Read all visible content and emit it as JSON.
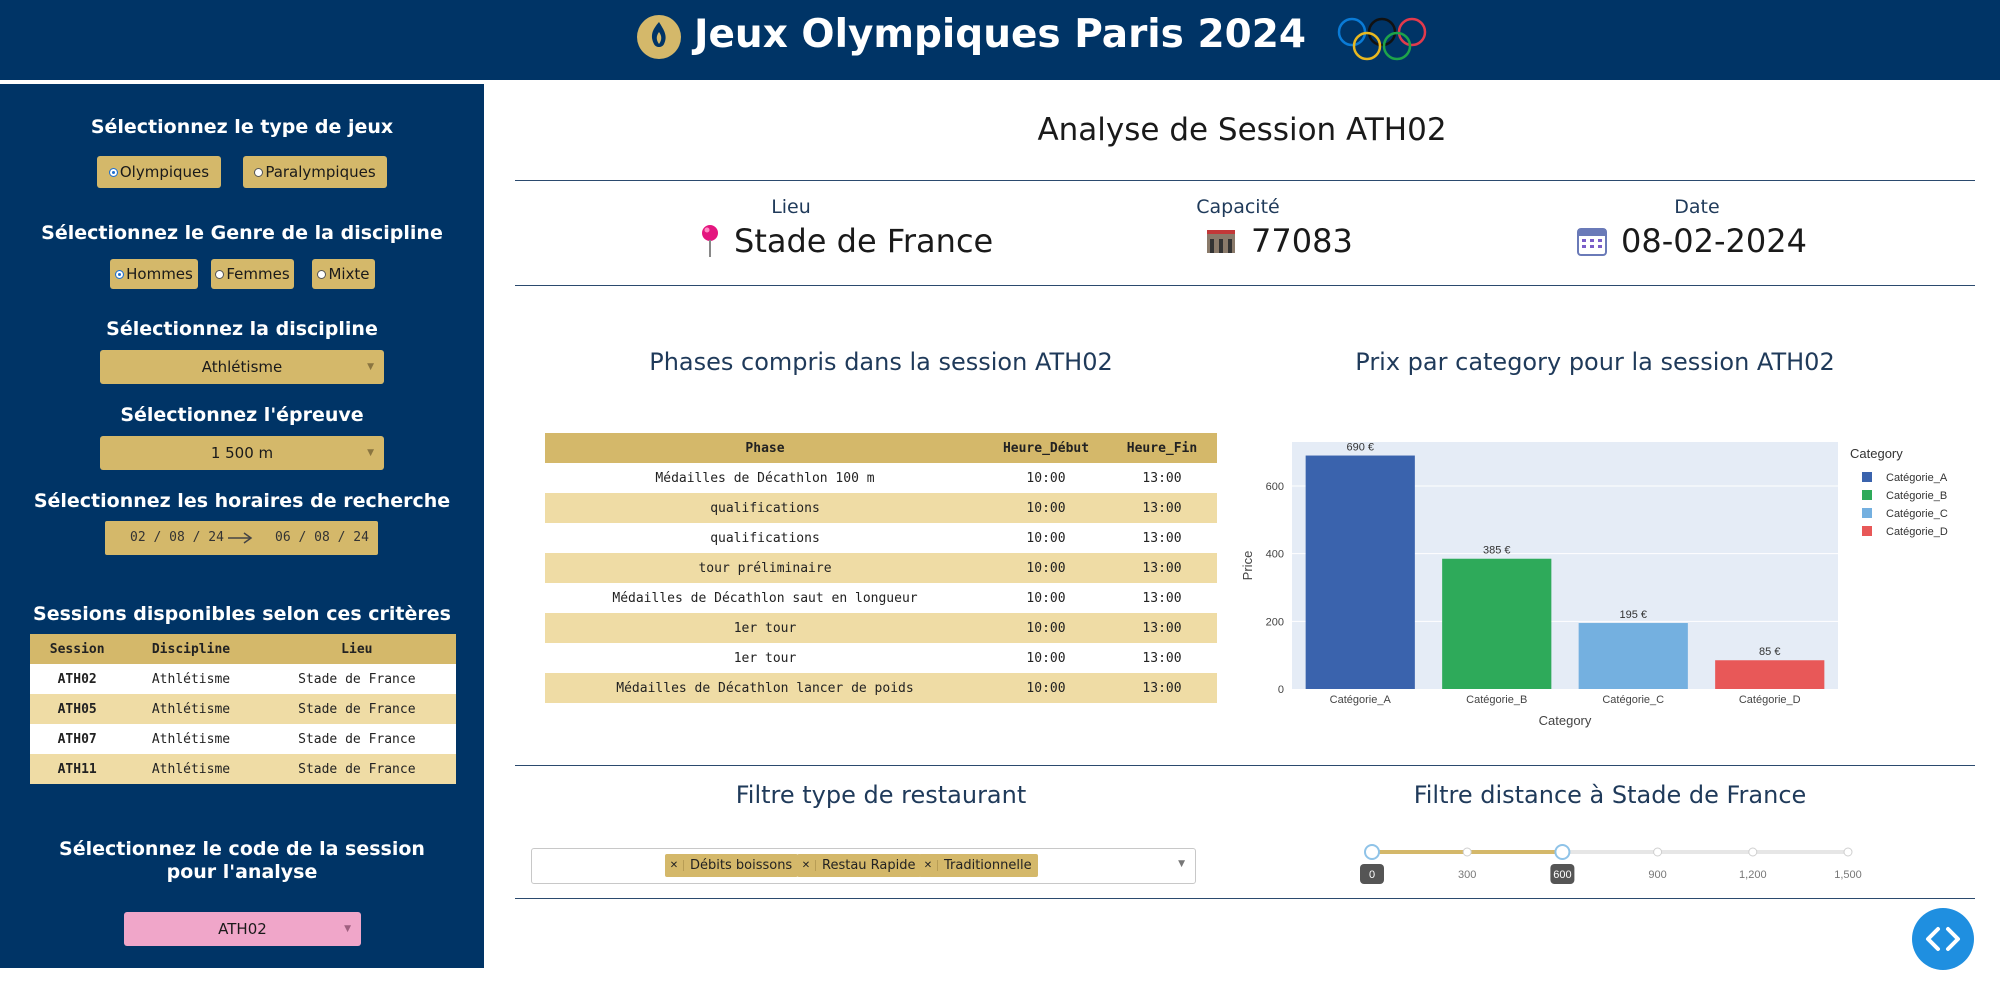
{
  "header": {
    "title": "Jeux Olympiques Paris 2024"
  },
  "sidebar": {
    "game_type": {
      "heading": "Sélectionnez le type de jeux",
      "options": [
        "Olympiques",
        "Paralympiques"
      ],
      "selected": "Olympiques"
    },
    "gender": {
      "heading": "Sélectionnez le Genre de la discipline",
      "options": [
        "Hommes",
        "Femmes",
        "Mixte"
      ],
      "selected": "Hommes"
    },
    "discipline": {
      "heading": "Sélectionnez la discipline",
      "value": "Athlétisme"
    },
    "event": {
      "heading": "Sélectionnez l'épreuve",
      "value": "1 500 m"
    },
    "dates": {
      "heading": "Sélectionnez les horaires de recherche",
      "start": "02 / 08 / 24",
      "end": "06 / 08 / 24"
    },
    "sessions": {
      "heading": "Sessions disponibles selon ces critères",
      "columns": [
        "Session",
        "Discipline",
        "Lieu"
      ],
      "rows": [
        [
          "ATH02",
          "Athlétisme",
          "Stade de France"
        ],
        [
          "ATH05",
          "Athlétisme",
          "Stade de France"
        ],
        [
          "ATH07",
          "Athlétisme",
          "Stade de France"
        ],
        [
          "ATH11",
          "Athlétisme",
          "Stade de France"
        ]
      ]
    },
    "session_code": {
      "heading": "Sélectionnez le code de la session pour l'analyse",
      "value": "ATH02"
    }
  },
  "main": {
    "title": "Analyse de Session ATH02",
    "info": {
      "lieu": {
        "label": "Lieu",
        "value": "Stade de France"
      },
      "capacite": {
        "label": "Capacité",
        "value": "77083"
      },
      "date": {
        "label": "Date",
        "value": "08-02-2024"
      }
    },
    "phases": {
      "title": "Phases compris dans la session ATH02",
      "columns": [
        "Phase",
        "Heure_Début",
        "Heure_Fin"
      ],
      "rows": [
        [
          "Médailles de Décathlon 100 m",
          "10:00",
          "13:00"
        ],
        [
          "qualifications",
          "10:00",
          "13:00"
        ],
        [
          "qualifications",
          "10:00",
          "13:00"
        ],
        [
          "tour préliminaire",
          "10:00",
          "13:00"
        ],
        [
          "Médailles de Décathlon saut en longueur",
          "10:00",
          "13:00"
        ],
        [
          "1er tour",
          "10:00",
          "13:00"
        ],
        [
          "1er tour",
          "10:00",
          "13:00"
        ],
        [
          "Médailles de Décathlon lancer de poids",
          "10:00",
          "13:00"
        ]
      ]
    },
    "price_chart_title": "Prix par category pour la session ATH02",
    "restaurant_filter": {
      "title": "Filtre type de restaurant",
      "tags": [
        "Débits boissons",
        "Restau Rapide",
        "Traditionnelle"
      ]
    },
    "distance_filter": {
      "title": "Filtre distance à Stade de France",
      "ticks": [
        "0",
        "300",
        "600",
        "900",
        "1,200",
        "1,500"
      ],
      "range": [
        0,
        600
      ]
    }
  },
  "chart_data": {
    "type": "bar",
    "categories": [
      "Catégorie_A",
      "Catégorie_B",
      "Catégorie_C",
      "Catégorie_D"
    ],
    "values": [
      690,
      385,
      195,
      85
    ],
    "data_labels": [
      "690 €",
      "385 €",
      "195 €",
      "85 €"
    ],
    "colors": [
      "#3a63ad",
      "#2eaa5a",
      "#74b0e0",
      "#e85858"
    ],
    "xlabel": "Category",
    "ylabel": "Price",
    "ylim": [
      0,
      730
    ],
    "yticks": [
      0,
      200,
      400,
      600
    ],
    "legend_title": "Category",
    "legend": [
      "Catégorie_A",
      "Catégorie_B",
      "Catégorie_C",
      "Catégorie_D"
    ],
    "legend_position": "top-right",
    "grid": true
  },
  "colors": {
    "navy": "#003466",
    "gold": "#d4b86a",
    "light_gold": "#efdca5",
    "pink": "#f0a6c9"
  }
}
